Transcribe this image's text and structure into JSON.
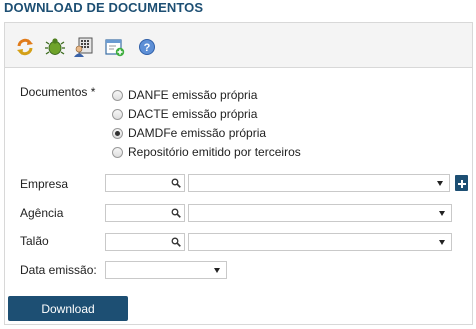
{
  "page_title": "DOWNLOAD DE DOCUMENTOS",
  "toolbar": {
    "icons": [
      "refresh-icon",
      "bug-icon",
      "calculator-user-icon",
      "add-window-icon",
      "help-icon"
    ]
  },
  "form": {
    "documentos_label": "Documentos *",
    "options": [
      {
        "label": "DANFE emissão própria",
        "checked": false
      },
      {
        "label": "DACTE emissão própria",
        "checked": false
      },
      {
        "label": "DAMDFe emissão própria",
        "checked": true
      },
      {
        "label": "Repositório emitido por terceiros",
        "checked": false
      }
    ],
    "empresa_label": "Empresa",
    "agencia_label": "Agência",
    "talao_label": "Talão",
    "data_emissao_label": "Data emissão:",
    "empresa_search": "",
    "empresa_select": "",
    "agencia_search": "",
    "agencia_select": "",
    "talao_search": "",
    "talao_select": "",
    "data_emissao_select": ""
  },
  "download_label": "Download",
  "colors": {
    "brand": "#1d4f73",
    "toolbar_bg": "#f4f4f4",
    "border": "#d8d8d8"
  }
}
